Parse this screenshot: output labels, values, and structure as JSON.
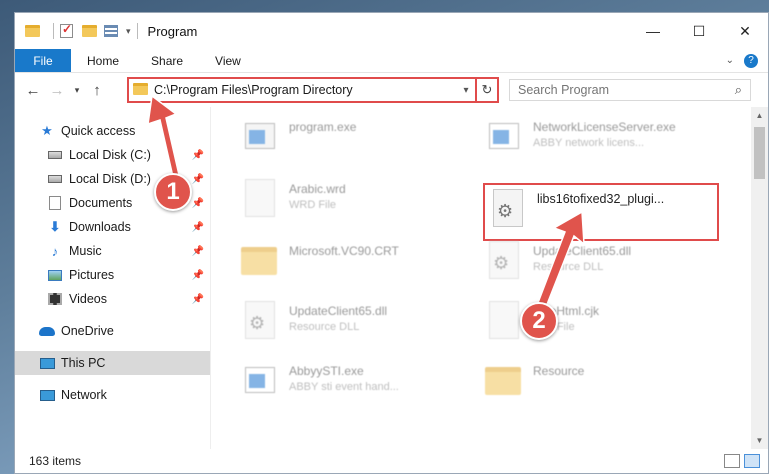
{
  "window": {
    "title": "Program",
    "controls": {
      "minimize": "—",
      "maximize": "☐",
      "close": "✕"
    }
  },
  "ribbon": {
    "tabs": [
      "File",
      "Home",
      "Share",
      "View"
    ],
    "expand_icon": "chevron-down-icon",
    "help_icon": "help-icon"
  },
  "nav": {
    "back": "←",
    "forward": "→",
    "recent": "▾",
    "up": "↑",
    "address": "C:\\Program Files\\Program Directory",
    "refresh": "↻",
    "search_placeholder": "Search Program",
    "search_icon": "⌕"
  },
  "sidebar": {
    "items": [
      {
        "label": "Quick access",
        "icon": "star-icon",
        "level": 0,
        "pinned": false
      },
      {
        "label": "Local Disk (C:)",
        "icon": "drive-icon",
        "level": 1,
        "pinned": true
      },
      {
        "label": "Local Disk (D:)",
        "icon": "drive-icon",
        "level": 1,
        "pinned": true
      },
      {
        "label": "Documents",
        "icon": "documents-icon",
        "level": 1,
        "pinned": true
      },
      {
        "label": "Downloads",
        "icon": "downloads-icon",
        "level": 1,
        "pinned": true
      },
      {
        "label": "Music",
        "icon": "music-icon",
        "level": 1,
        "pinned": true
      },
      {
        "label": "Pictures",
        "icon": "pictures-icon",
        "level": 1,
        "pinned": true
      },
      {
        "label": "Videos",
        "icon": "videos-icon",
        "level": 1,
        "pinned": true
      },
      {
        "label": "OneDrive",
        "icon": "onedrive-icon",
        "level": 0,
        "pinned": false
      },
      {
        "label": "This PC",
        "icon": "this-pc-icon",
        "level": 0,
        "pinned": false,
        "selected": true
      },
      {
        "label": "Network",
        "icon": "network-icon",
        "level": 0,
        "pinned": false
      }
    ]
  },
  "files": [
    {
      "name": "program.exe",
      "type": "",
      "icon": "program-exe-icon"
    },
    {
      "name": "NetworkLicenseServer.exe",
      "type": "ABBY network licens...",
      "icon": "app-icon"
    },
    {
      "name": "Arabic.wrd",
      "type": "WRD File",
      "icon": "file-icon"
    },
    {
      "name": "libs16tofixed32_plugi...",
      "type": "",
      "icon": "dll-gear-icon",
      "highlighted": true
    },
    {
      "name": "Microsoft.VC90.CRT",
      "type": "",
      "icon": "folder-icon"
    },
    {
      "name": "UpdateClient65.dll",
      "type": "Resource DLL",
      "icon": "dll-gear-icon"
    },
    {
      "name": "UpdateClient65.dll",
      "type": "Resource DLL",
      "icon": "dll-gear-icon"
    },
    {
      "name": "FineHtml.cjk",
      "type": "CJK File",
      "icon": "file-icon"
    },
    {
      "name": "AbbyySTI.exe",
      "type": "ABBY sti event hand...",
      "icon": "app-icon"
    },
    {
      "name": "Resource",
      "type": "",
      "icon": "folder-icon"
    }
  ],
  "status": {
    "count": "163 items"
  },
  "annotations": {
    "step1": "1",
    "step2": "2",
    "accent": "#e04b4b"
  }
}
